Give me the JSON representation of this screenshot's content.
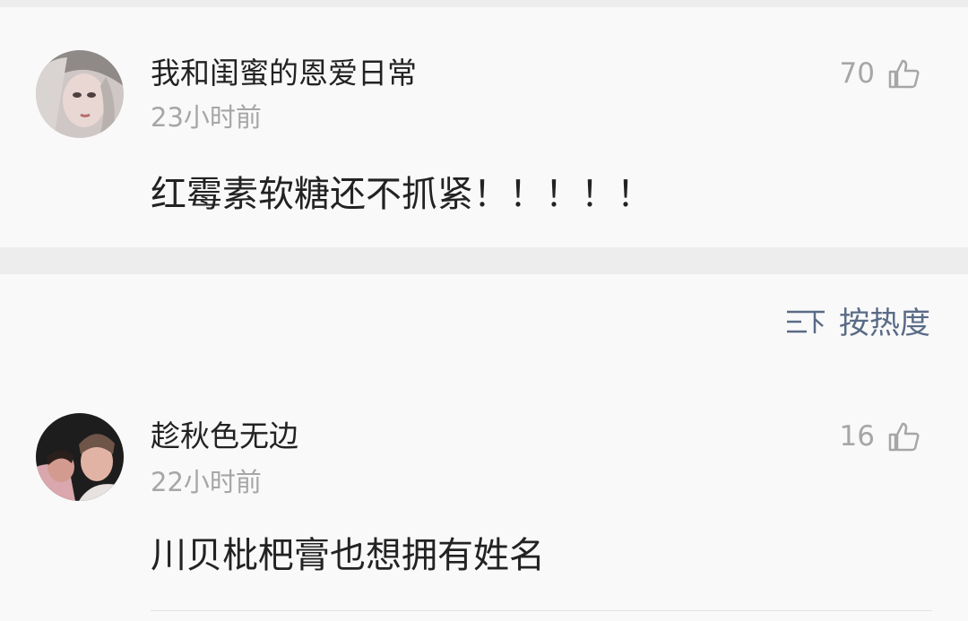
{
  "comments": [
    {
      "username": "我和闺蜜的恩爱日常",
      "time": "23小时前",
      "content": "红霉素软糖还不抓紧！！！！！",
      "likes": "70",
      "avatar_icon": "avatar-girl-photo"
    },
    {
      "username": "趁秋色无边",
      "time": "22小时前",
      "content": "川贝枇杷膏也想拥有姓名",
      "likes": "16",
      "avatar_icon": "avatar-couple-photo"
    }
  ],
  "sort": {
    "label": "按热度",
    "icon": "sort-icon"
  },
  "colors": {
    "background": "#ededed",
    "card": "#f9f9f9",
    "text": "#222222",
    "muted": "#a6a6a6",
    "sort_text": "#5a6b86"
  }
}
